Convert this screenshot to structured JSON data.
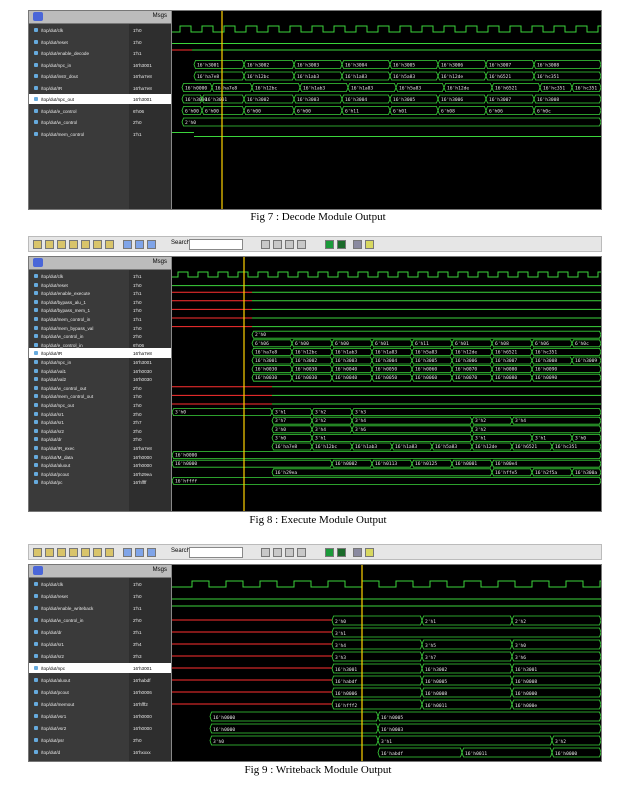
{
  "figures": [
    {
      "id": "fig7",
      "caption": "Fig 7 : Decode Module Output",
      "header_label": "Msgs",
      "signals": [
        {
          "name": "/top/dut/clk",
          "value": "1'h0"
        },
        {
          "name": "/top/dut/reset",
          "value": "1'h0"
        },
        {
          "name": "/top/dut/enable_decode",
          "value": "1'h1"
        },
        {
          "name": "/top/dut/npc_in",
          "value": "16'h3001"
        },
        {
          "name": "/top/dut/instr_dout",
          "value": "16'ha7e8"
        },
        {
          "name": "/top/dut/IR",
          "value": "16'ha7e8"
        },
        {
          "name": "/top/dut/npc_out",
          "value": "16'h3001"
        },
        {
          "name": "/top/dut/e_control",
          "value": "6'h06"
        },
        {
          "name": "/top/dut/w_control",
          "value": "2'h0"
        },
        {
          "name": "/top/dut/mem_control",
          "value": "1'h1"
        }
      ],
      "bus_labels": [
        [
          "16'h3001",
          "16'h3002",
          "16'h3003",
          "16'h3004",
          "16'h3005",
          "16'h3006",
          "16'h3007",
          "16'h3008"
        ],
        [
          "16'ha7e8",
          "16'h12bc",
          "16'h1ab3",
          "16'h1a83",
          "16'h5a83",
          "16'h12de",
          "16'h6521",
          "16'hc351"
        ],
        [
          "16'h0000",
          "16'ha7e8",
          "16'h12bc",
          "16'h1ab3",
          "16'h1a83",
          "16'h5a83",
          "16'h12de",
          "16'h6521",
          "16'hc351",
          "16'hc351"
        ],
        [
          "16'h3000",
          "16'h3001",
          "16'h3002",
          "16'h3003",
          "16'h3004",
          "16'h3005",
          "16'h3006",
          "16'h3007",
          "16'h3008"
        ],
        [
          "6'h00",
          "6'h00",
          "6'h00",
          "6'h00",
          "6'h11",
          "6'h01",
          "6'h08",
          "6'h06",
          "6'h0c"
        ],
        [
          "2'h0"
        ]
      ]
    },
    {
      "id": "fig8",
      "caption": "Fig 8 : Execute Module Output",
      "header_label": "Msgs",
      "search_label": "Search:",
      "signals": [
        {
          "name": "/top/dut/clk",
          "value": "1'h1"
        },
        {
          "name": "/top/dut/reset",
          "value": "1'h0"
        },
        {
          "name": "/top/dut/enable_execute",
          "value": "1'h1"
        },
        {
          "name": "/top/dut/bypass_alu_1",
          "value": "1'h0"
        },
        {
          "name": "/top/dut/bypass_mem_1",
          "value": "1'h0"
        },
        {
          "name": "/top/dut/mem_control_in",
          "value": "1'h1"
        },
        {
          "name": "/top/dut/mem_bypass_val",
          "value": "1'h0"
        },
        {
          "name": "/top/dut/w_control_in",
          "value": "2'h0"
        },
        {
          "name": "/top/dut/e_control_in",
          "value": "6'h06"
        },
        {
          "name": "/top/dut/IR",
          "value": "16'ha7e8"
        },
        {
          "name": "/top/dut/npc_in",
          "value": "16'h3001"
        },
        {
          "name": "/top/dut/val1",
          "value": "16'h0030"
        },
        {
          "name": "/top/dut/val2",
          "value": "16'h0030"
        },
        {
          "name": "/top/dut/w_control_out",
          "value": "2'h0"
        },
        {
          "name": "/top/dut/mem_control_out",
          "value": "1'h0"
        },
        {
          "name": "/top/dut/npc_out",
          "value": "1'h0"
        },
        {
          "name": "/top/dut/sr1",
          "value": "3'h0"
        },
        {
          "name": "/top/dut/sr1",
          "value": "3'h7"
        },
        {
          "name": "/top/dut/sr2",
          "value": "3'h0"
        },
        {
          "name": "/top/dut/dr",
          "value": "3'h0"
        },
        {
          "name": "/top/dut/IR_exec",
          "value": "16'ha7e8"
        },
        {
          "name": "/top/dut/M_data",
          "value": "16'h0000"
        },
        {
          "name": "/top/dut/aluout",
          "value": "16'h0000"
        },
        {
          "name": "/top/dut/pcout",
          "value": "16'h29ea"
        },
        {
          "name": "/top/dut/pc",
          "value": "16'hffff"
        }
      ],
      "bus_labels": [
        [
          "6'h06",
          "6'h00",
          "6'h00",
          "6'h01",
          "6'h11",
          "6'h01",
          "6'h08",
          "6'h06",
          "6'h0c"
        ],
        [
          "16'ha7e8",
          "16'h12bc",
          "16'h1ab3",
          "16'h1a83",
          "16'h5a83",
          "16'h12de",
          "16'h6521",
          "16'hc351"
        ],
        [
          "16'h3001",
          "16'h3002",
          "16'h3003",
          "16'h3004",
          "16'h3005",
          "16'h3006",
          "16'h3007",
          "16'h3008",
          "16'h3009"
        ],
        [
          "16'h0030",
          "16'h0030",
          "16'h0040",
          "16'h0050",
          "16'h0060",
          "16'h0070",
          "16'h0080",
          "16'h0090"
        ],
        [
          "3'h0",
          "3'h1",
          "3'h2",
          "3'h3",
          "3'h4",
          "3'h5",
          "3'h6"
        ],
        [
          "16'ha7e8",
          "16'h12bc",
          "16'h1ab3",
          "16'h1a83",
          "16'h5a83",
          "16'h12de",
          "16'h6521",
          "16'hc351"
        ],
        [
          "16'h0000",
          "16'h0002",
          "16'h0113",
          "16'h0125",
          "16'h0001",
          "16'h00e4"
        ],
        [
          "16'h29ea",
          "16'hffe5",
          "16'h2f5a",
          "16'h300a"
        ]
      ]
    },
    {
      "id": "fig9",
      "caption": "Fig 9 : Writeback Module Output",
      "header_label": "Msgs",
      "search_label": "Search:",
      "signals": [
        {
          "name": "/top/dut/clk",
          "value": "1'h0"
        },
        {
          "name": "/top/dut/reset",
          "value": "1'h0"
        },
        {
          "name": "/top/dut/enable_writeback",
          "value": "1'h1"
        },
        {
          "name": "/top/dut/w_control_in",
          "value": "2'h0"
        },
        {
          "name": "/top/dut/dr",
          "value": "3'h1"
        },
        {
          "name": "/top/dut/sr1",
          "value": "3'h4"
        },
        {
          "name": "/top/dut/sr2",
          "value": "3'h3"
        },
        {
          "name": "/top/dut/npc",
          "value": "16'h3001"
        },
        {
          "name": "/top/dut/aluout",
          "value": "16'habdf"
        },
        {
          "name": "/top/dut/pcout",
          "value": "16'h0006"
        },
        {
          "name": "/top/dut/memout",
          "value": "16'hfff2"
        },
        {
          "name": "/top/dut/vsr1",
          "value": "16'h0000"
        },
        {
          "name": "/top/dut/vsr2",
          "value": "16'h0000"
        },
        {
          "name": "/top/dut/psr",
          "value": "3'h0"
        },
        {
          "name": "/top/dut/d",
          "value": "16'hxxxx"
        }
      ],
      "bus_labels": [
        [
          "2'h0",
          "2'h1",
          "2'h2"
        ],
        [
          "3'h1"
        ],
        [
          "3'h4",
          "3'h5",
          "3'h0"
        ],
        [
          "3'h3",
          "3'h7",
          "3'h6"
        ],
        [
          "16'h3001",
          "16'h3002",
          "16'h3001"
        ],
        [
          "16'habdf",
          "16'h0005",
          "16'h0008"
        ],
        [
          "16'h0006",
          "16'h0008",
          "16'h0000"
        ],
        [
          "16'hfff2",
          "16'h0011",
          "16'h000e"
        ],
        [
          "16'h0000",
          "16'h0005"
        ],
        [
          "16'h0000",
          "16'h0003"
        ],
        [
          "3'h0",
          "3'h1",
          "3'h2"
        ],
        [
          "16'habdf",
          "16'h0011",
          "16'h0000"
        ]
      ]
    }
  ]
}
